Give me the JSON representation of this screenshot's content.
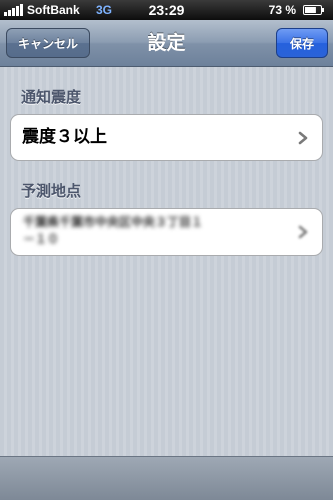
{
  "status_bar": {
    "carrier": "SoftBank",
    "network": "3G",
    "time": "23:29",
    "battery_percent": "73 %",
    "battery_level": 0.73,
    "signal_icon": "signal-bars-icon",
    "battery_icon": "battery-icon"
  },
  "nav": {
    "title": "設定",
    "cancel_label": "キャンセル",
    "save_label": "保存"
  },
  "sections": [
    {
      "header": "通知震度",
      "cell_value": "震度３以上",
      "accessory_icon": "chevron-right-icon"
    },
    {
      "header": "予測地点",
      "cell_value": "千葉県千葉市中央区中央３丁目１\n－１０",
      "accessory_icon": "chevron-right-icon"
    }
  ],
  "colors": {
    "nav_bar": "#8c9db2",
    "save_button": "#3b72e6",
    "background": "#c5ccd5",
    "section_header": "#4c566c"
  }
}
